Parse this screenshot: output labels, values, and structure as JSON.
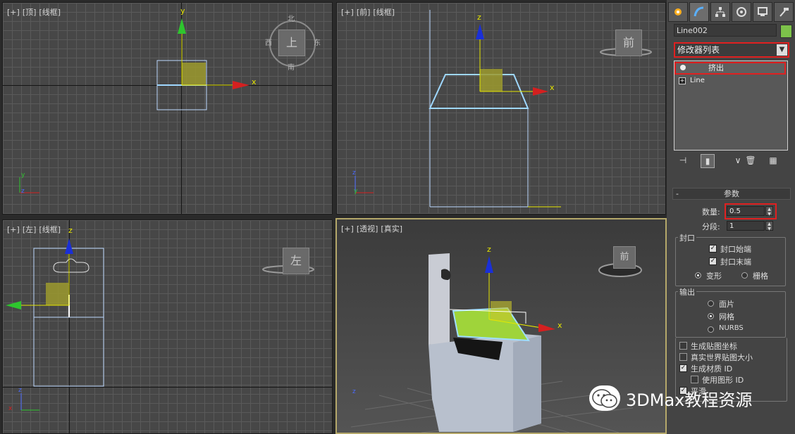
{
  "viewports": {
    "top": {
      "plus": "[+]",
      "view": "[顶]",
      "shade": "[线框]",
      "cube_label": "上",
      "compass": {
        "n": "北",
        "s": "南",
        "e": "东",
        "w": "西"
      }
    },
    "front": {
      "plus": "[+]",
      "view": "[前]",
      "shade": "[线框]",
      "cube_label": "前"
    },
    "left": {
      "plus": "[+]",
      "view": "[左]",
      "shade": "[线框]",
      "cube_label": "左"
    },
    "persp": {
      "plus": "[+]",
      "view": "[透视]",
      "shade": "[真实]",
      "cube_label": "前"
    }
  },
  "axes": {
    "x": "x",
    "y": "y",
    "z": "z"
  },
  "panel": {
    "tabs": [
      "create-icon",
      "modify-icon",
      "hierarchy-icon",
      "motion-icon",
      "display-icon",
      "utilities-icon"
    ],
    "object_name": "Line002",
    "object_color": "#7dc24a",
    "modifier_list": "修改器列表",
    "stack": [
      {
        "label": "挤出",
        "icon": "bulb-icon",
        "selected": true
      },
      {
        "label": "Line",
        "icon": "expand-icon",
        "selected": false
      }
    ],
    "params_title": "参数",
    "amount_label": "数量:",
    "amount_value": "0.5",
    "segments_label": "分段:",
    "segments_value": "1",
    "capping": {
      "title": "封口",
      "cap_start": "封口始端",
      "cap_end": "封口末端",
      "morph": "变形",
      "grid": "栅格"
    },
    "output": {
      "title": "输出",
      "patch": "面片",
      "mesh": "网格",
      "nurbs": "NURBS"
    },
    "gen_mapping": "生成贴图坐标",
    "real_world": "真实世界贴图大小",
    "gen_mat_id": "生成材质 ID",
    "use_shape_id": "使用图形 ID",
    "smooth": "平滑"
  },
  "watermark": "3DMax教程资源"
}
